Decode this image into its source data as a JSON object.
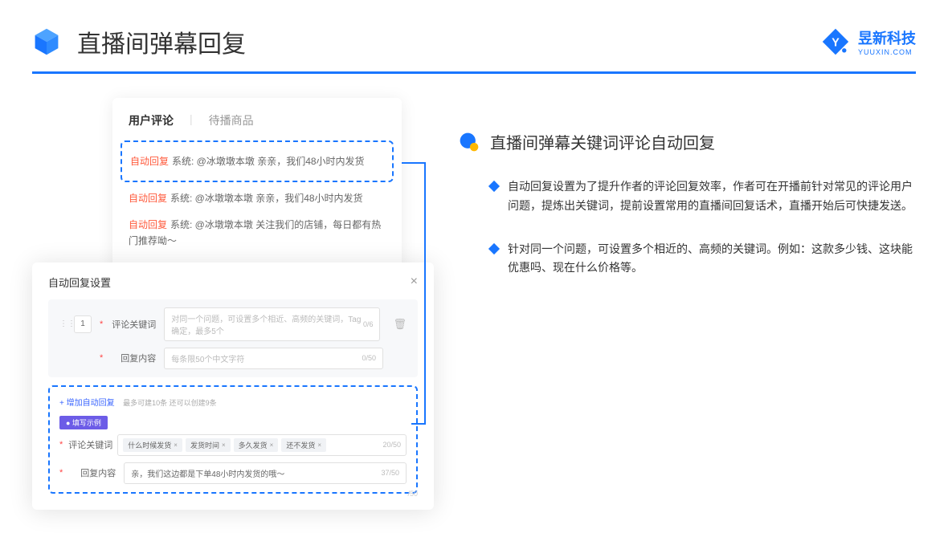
{
  "header": {
    "title": "直播间弹幕回复",
    "brand_name": "昱新科技",
    "brand_sub": "YUUXIN.COM"
  },
  "comments_panel": {
    "tab_active": "用户评论",
    "tab_inactive": "待播商品",
    "items": [
      {
        "tag": "自动回复",
        "text": "系统: @冰墩墩本墩 亲亲，我们48小时内发货"
      },
      {
        "tag": "自动回复",
        "text": "系统: @冰墩墩本墩 亲亲，我们48小时内发货"
      },
      {
        "tag": "自动回复",
        "text": "系统: @冰墩墩本墩 关注我们的店铺，每日都有热门推荐呦～"
      }
    ]
  },
  "modal": {
    "title": "自动回复设置",
    "order": "1",
    "label_keyword": "评论关键词",
    "placeholder_keyword": "对同一个问题，可设置多个相近、高频的关键词，Tag确定，最多5个",
    "counter_keyword": "0/6",
    "label_content": "回复内容",
    "placeholder_content": "每条限50个中文字符",
    "counter_content": "0/50",
    "add_link": "+ 增加自动回复",
    "add_hint": "最多可建10条 还可以创建9条",
    "example_badge": "● 填写示例",
    "ex_label_keyword": "评论关键词",
    "ex_tags": [
      "什么时候发货",
      "发货时间",
      "多久发货",
      "还不发货"
    ],
    "ex_counter_keyword": "20/50",
    "ex_label_content": "回复内容",
    "ex_content": "亲，我们这边都是下单48小时内发货的哦～",
    "ex_counter_content": "37/50",
    "ghost_counter": "/50"
  },
  "right": {
    "section_title": "直播间弹幕关键词评论自动回复",
    "bullets": [
      "自动回复设置为了提升作者的评论回复效率，作者可在开播前针对常见的评论用户问题，提炼出关键词，提前设置常用的直播间回复话术，直播开始后可快捷发送。",
      "针对同一个问题，可设置多个相近的、高频的关键词。例如：这款多少钱、这块能优惠吗、现在什么价格等。"
    ]
  }
}
